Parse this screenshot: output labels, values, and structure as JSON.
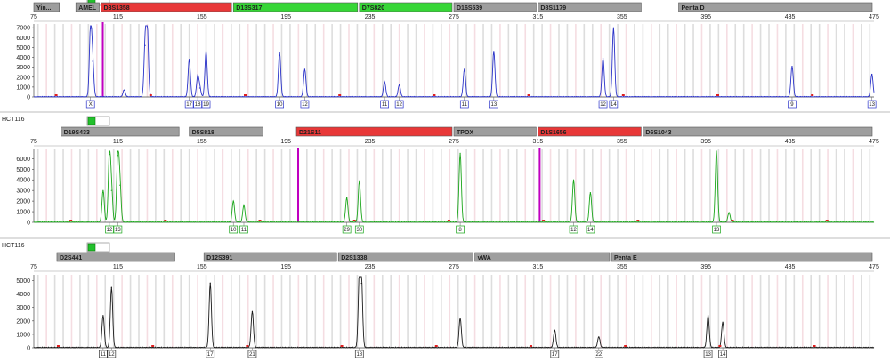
{
  "app": {
    "green_color": "#22c02c",
    "grid_color": "#cfcfcf",
    "bin_color": "#f2d0d6",
    "marker_line_color": "#c000c0"
  },
  "chart_data": [
    {
      "type": "line",
      "sample_label": "",
      "color": "#2a32c8",
      "xlim": [
        75,
        475
      ],
      "ylim": [
        0,
        7200
      ],
      "x_ticks": [
        75,
        115,
        155,
        195,
        235,
        275,
        315,
        355,
        395,
        435,
        475
      ],
      "y_ticks": [
        0,
        1000,
        2000,
        3000,
        4000,
        5000,
        6000,
        7000
      ],
      "markers": [
        {
          "label": "Yin...",
          "start": 75,
          "end": 88,
          "color": "#9e9e9e"
        },
        {
          "label": "AMEL",
          "start": 95,
          "end": 107,
          "color": "#9e9e9e"
        },
        {
          "label": "D3S1358",
          "start": 107,
          "end": 170,
          "color": "#e83838"
        },
        {
          "label": "D13S317",
          "start": 170,
          "end": 230,
          "color": "#36d636"
        },
        {
          "label": "D7S820",
          "start": 230,
          "end": 275,
          "color": "#36d636"
        },
        {
          "label": "D16S539",
          "start": 275,
          "end": 315,
          "color": "#9e9e9e"
        },
        {
          "label": "D8S1179",
          "start": 315,
          "end": 365,
          "color": "#9e9e9e"
        },
        {
          "label": "Penta D",
          "start": 382,
          "end": 475,
          "color": "#9e9e9e"
        }
      ],
      "peaks": [
        {
          "x": 102,
          "y": 6900
        },
        {
          "x": 103,
          "y": 3600
        },
        {
          "x": 118,
          "y": 700
        },
        {
          "x": 128,
          "y": 5200
        },
        {
          "x": 129,
          "y": 7000
        },
        {
          "x": 149,
          "y": 3800
        },
        {
          "x": 153,
          "y": 2000
        },
        {
          "x": 154,
          "y": 900
        },
        {
          "x": 157,
          "y": 4600
        },
        {
          "x": 192,
          "y": 4500
        },
        {
          "x": 204,
          "y": 2800
        },
        {
          "x": 242,
          "y": 1500
        },
        {
          "x": 249,
          "y": 1200
        },
        {
          "x": 280,
          "y": 2800
        },
        {
          "x": 294,
          "y": 4600
        },
        {
          "x": 346,
          "y": 3900
        },
        {
          "x": 351,
          "y": 7000
        },
        {
          "x": 436,
          "y": 3100
        },
        {
          "x": 474,
          "y": 2300
        }
      ],
      "alleles": [
        {
          "label": "X",
          "x": 102
        },
        {
          "label": "17",
          "x": 149
        },
        {
          "label": "18",
          "x": 153
        },
        {
          "label": "19",
          "x": 157
        },
        {
          "label": "10",
          "x": 192
        },
        {
          "label": "12",
          "x": 204
        },
        {
          "label": "11",
          "x": 242
        },
        {
          "label": "12",
          "x": 249
        },
        {
          "label": "11",
          "x": 280
        },
        {
          "label": "13",
          "x": 294
        },
        {
          "label": "12",
          "x": 346
        },
        {
          "label": "14",
          "x": 351
        },
        {
          "label": "9",
          "x": 436
        },
        {
          "label": "13",
          "x": 474
        }
      ]
    },
    {
      "type": "line",
      "sample_label": "HCT116",
      "color": "#1aa61a",
      "xlim": [
        75,
        475
      ],
      "ylim": [
        0,
        6700
      ],
      "x_ticks": [
        75,
        115,
        155,
        195,
        235,
        275,
        315,
        355,
        395,
        435,
        475
      ],
      "y_ticks": [
        0,
        1000,
        2000,
        3000,
        4000,
        5000,
        6000
      ],
      "markers": [
        {
          "label": "D19S433",
          "start": 88,
          "end": 145,
          "color": "#9e9e9e"
        },
        {
          "label": "D5S818",
          "start": 149,
          "end": 185,
          "color": "#9e9e9e"
        },
        {
          "label": "D21S11",
          "start": 200,
          "end": 275,
          "color": "#e83838"
        },
        {
          "label": "TPOX",
          "start": 275,
          "end": 315,
          "color": "#9e9e9e"
        },
        {
          "label": "D1S1656",
          "start": 315,
          "end": 365,
          "color": "#e83838"
        },
        {
          "label": "D6S1043",
          "start": 365,
          "end": 475,
          "color": "#9e9e9e"
        }
      ],
      "peaks": [
        {
          "x": 108,
          "y": 3000
        },
        {
          "x": 111,
          "y": 6400
        },
        {
          "x": 112,
          "y": 3000
        },
        {
          "x": 115,
          "y": 6300
        },
        {
          "x": 116,
          "y": 3500
        },
        {
          "x": 170,
          "y": 2000
        },
        {
          "x": 175,
          "y": 1600
        },
        {
          "x": 224,
          "y": 2300
        },
        {
          "x": 230,
          "y": 3900
        },
        {
          "x": 278,
          "y": 6500
        },
        {
          "x": 332,
          "y": 4000
        },
        {
          "x": 340,
          "y": 2800
        },
        {
          "x": 400,
          "y": 6700
        },
        {
          "x": 406,
          "y": 900
        }
      ],
      "alleles": [
        {
          "label": "12",
          "x": 111
        },
        {
          "label": "13",
          "x": 115
        },
        {
          "label": "10",
          "x": 170
        },
        {
          "label": "11",
          "x": 175
        },
        {
          "label": "29",
          "x": 224
        },
        {
          "label": "30",
          "x": 230
        },
        {
          "label": "8",
          "x": 278
        },
        {
          "label": "12",
          "x": 332
        },
        {
          "label": "14",
          "x": 340
        },
        {
          "label": "13",
          "x": 400
        }
      ]
    },
    {
      "type": "line",
      "sample_label": "HCT116",
      "color": "#1a1a1a",
      "xlim": [
        75,
        475
      ],
      "ylim": [
        0,
        5300
      ],
      "x_ticks": [
        75,
        115,
        155,
        195,
        235,
        275,
        315,
        355,
        395,
        435,
        475
      ],
      "y_ticks": [
        0,
        1000,
        2000,
        3000,
        4000,
        5000
      ],
      "markers": [
        {
          "label": "D2S441",
          "start": 86,
          "end": 143,
          "color": "#9e9e9e"
        },
        {
          "label": "D12S391",
          "start": 156,
          "end": 220,
          "color": "#9e9e9e"
        },
        {
          "label": "D2S1338",
          "start": 220,
          "end": 285,
          "color": "#9e9e9e"
        },
        {
          "label": "vWA",
          "start": 285,
          "end": 350,
          "color": "#9e9e9e"
        },
        {
          "label": "Penta E",
          "start": 350,
          "end": 475,
          "color": "#9e9e9e"
        }
      ],
      "peaks": [
        {
          "x": 108,
          "y": 2400
        },
        {
          "x": 112,
          "y": 4500
        },
        {
          "x": 159,
          "y": 4800
        },
        {
          "x": 179,
          "y": 2700
        },
        {
          "x": 230,
          "y": 5300
        },
        {
          "x": 231,
          "y": 4800
        },
        {
          "x": 278,
          "y": 2200
        },
        {
          "x": 323,
          "y": 1300
        },
        {
          "x": 344,
          "y": 800
        },
        {
          "x": 396,
          "y": 2400
        },
        {
          "x": 403,
          "y": 1900
        }
      ],
      "alleles": [
        {
          "label": "11",
          "x": 108
        },
        {
          "label": "12",
          "x": 112
        },
        {
          "label": "17",
          "x": 159
        },
        {
          "label": "21",
          "x": 179
        },
        {
          "label": "18",
          "x": 230
        },
        {
          "label": "17",
          "x": 323
        },
        {
          "label": "22",
          "x": 344
        },
        {
          "label": "13",
          "x": 396
        },
        {
          "label": "14",
          "x": 403
        }
      ]
    }
  ]
}
